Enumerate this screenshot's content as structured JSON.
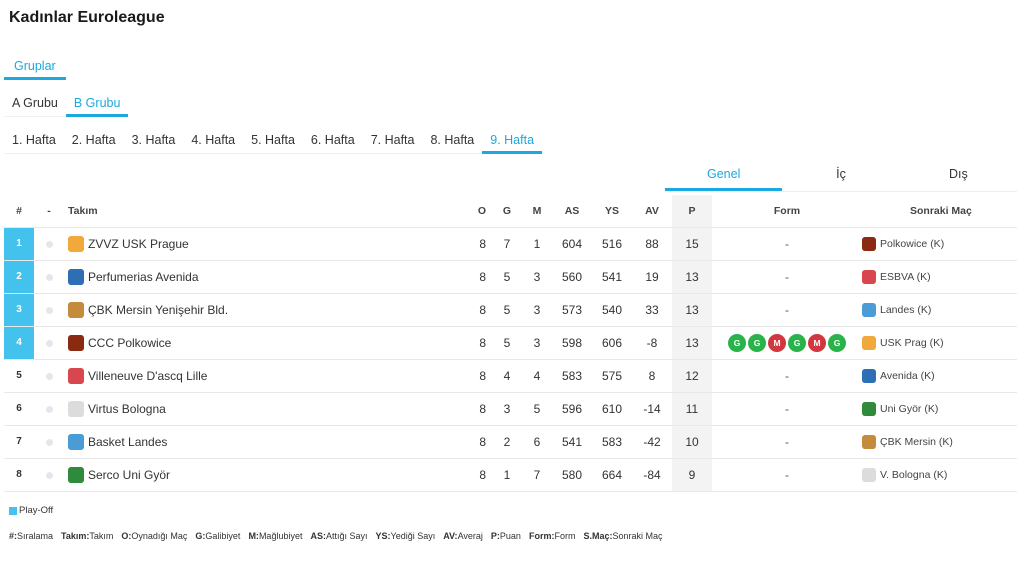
{
  "title": "Kadınlar Euroleague",
  "groups_tab": {
    "label": "Gruplar"
  },
  "group_tabs": [
    {
      "label": "A Grubu",
      "active": false
    },
    {
      "label": "B Grubu",
      "active": true
    }
  ],
  "week_tabs": [
    {
      "label": "1. Hafta",
      "active": false
    },
    {
      "label": "2. Hafta",
      "active": false
    },
    {
      "label": "3. Hafta",
      "active": false
    },
    {
      "label": "4. Hafta",
      "active": false
    },
    {
      "label": "5. Hafta",
      "active": false
    },
    {
      "label": "6. Hafta",
      "active": false
    },
    {
      "label": "7. Hafta",
      "active": false
    },
    {
      "label": "8. Hafta",
      "active": false
    },
    {
      "label": "9. Hafta",
      "active": true
    }
  ],
  "view_tabs": [
    {
      "label": "Genel",
      "active": true
    },
    {
      "label": "İç",
      "active": false
    },
    {
      "label": "Dış",
      "active": false
    }
  ],
  "columns": {
    "rank": "#",
    "dot": "-",
    "team": "Takım",
    "o": "O",
    "g": "G",
    "m": "M",
    "as": "AS",
    "ys": "YS",
    "av": "AV",
    "p": "P",
    "form": "Form",
    "next": "Sonraki Maç"
  },
  "rows": [
    {
      "rank": "1",
      "playoff": true,
      "team": "ZVVZ USK Prague",
      "logo_color": "#f2a93b",
      "logo_text": "USK",
      "o": "8",
      "g": "7",
      "m": "1",
      "as": "604",
      "ys": "516",
      "av": "88",
      "p": "15",
      "form": [],
      "form_empty": "-",
      "next": "Polkowice (K)",
      "next_logo_color": "#8a2a10",
      "next_logo_text": "CCC"
    },
    {
      "rank": "2",
      "playoff": true,
      "team": "Perfumerias Avenida",
      "logo_color": "#2c6fb5",
      "logo_text": "PA",
      "o": "8",
      "g": "5",
      "m": "3",
      "as": "560",
      "ys": "541",
      "av": "19",
      "p": "13",
      "form": [],
      "form_empty": "-",
      "next": "ESBVA (K)",
      "next_logo_color": "#d8474e",
      "next_logo_text": "VL"
    },
    {
      "rank": "3",
      "playoff": true,
      "team": "ÇBK Mersin Yenişehir Bld.",
      "logo_color": "#c58b3c",
      "logo_text": "ÇBK",
      "o": "8",
      "g": "5",
      "m": "3",
      "as": "573",
      "ys": "540",
      "av": "33",
      "p": "13",
      "form": [],
      "form_empty": "-",
      "next": "Landes (K)",
      "next_logo_color": "#4a9bd6",
      "next_logo_text": "BL"
    },
    {
      "rank": "4",
      "playoff": true,
      "team": "CCC Polkowice",
      "logo_color": "#8a2a10",
      "logo_text": "CCC",
      "o": "8",
      "g": "5",
      "m": "3",
      "as": "598",
      "ys": "606",
      "av": "-8",
      "p": "13",
      "form": [
        "G",
        "G",
        "M",
        "G",
        "M",
        "G"
      ],
      "form_empty": "",
      "next": "USK Prag (K)",
      "next_logo_color": "#f2a93b",
      "next_logo_text": "USK"
    },
    {
      "rank": "5",
      "playoff": false,
      "team": "Villeneuve D'ascq Lille",
      "logo_color": "#d8474e",
      "logo_text": "VL",
      "o": "8",
      "g": "4",
      "m": "4",
      "as": "583",
      "ys": "575",
      "av": "8",
      "p": "12",
      "form": [],
      "form_empty": "-",
      "next": "Avenida (K)",
      "next_logo_color": "#2c6fb5",
      "next_logo_text": "PA"
    },
    {
      "rank": "6",
      "playoff": false,
      "team": "Virtus Bologna",
      "logo_color": "#dcdcdc",
      "logo_text": "VB",
      "o": "8",
      "g": "3",
      "m": "5",
      "as": "596",
      "ys": "610",
      "av": "-14",
      "p": "11",
      "form": [],
      "form_empty": "-",
      "next": "Uni Györ (K)",
      "next_logo_color": "#2f8a3c",
      "next_logo_text": "UG"
    },
    {
      "rank": "7",
      "playoff": false,
      "team": "Basket Landes",
      "logo_color": "#4a9bd6",
      "logo_text": "BL",
      "o": "8",
      "g": "2",
      "m": "6",
      "as": "541",
      "ys": "583",
      "av": "-42",
      "p": "10",
      "form": [],
      "form_empty": "-",
      "next": "ÇBK Mersin (K)",
      "next_logo_color": "#c58b3c",
      "next_logo_text": "ÇBK"
    },
    {
      "rank": "8",
      "playoff": false,
      "team": "Serco Uni Györ",
      "logo_color": "#2f8a3c",
      "logo_text": "UG",
      "o": "8",
      "g": "1",
      "m": "7",
      "as": "580",
      "ys": "664",
      "av": "-84",
      "p": "9",
      "form": [],
      "form_empty": "-",
      "next": "V. Bologna (K)",
      "next_logo_color": "#dcdcdc",
      "next_logo_text": "VB"
    }
  ],
  "legend": {
    "label": "Play-Off",
    "color": "#44c2ee"
  },
  "abbreviations": [
    {
      "key": "#:",
      "value": "Sıralama"
    },
    {
      "key": "Takım:",
      "value": "Takım"
    },
    {
      "key": "O:",
      "value": "Oynadığı Maç"
    },
    {
      "key": "G:",
      "value": "Galibiyet"
    },
    {
      "key": "M:",
      "value": "Mağlubiyet"
    },
    {
      "key": "AS:",
      "value": "Attığı Sayı"
    },
    {
      "key": "YS:",
      "value": "Yediği Sayı"
    },
    {
      "key": "AV:",
      "value": "Averaj"
    },
    {
      "key": "P:",
      "value": "Puan"
    },
    {
      "key": "Form:",
      "value": "Form"
    },
    {
      "key": "S.Maç:",
      "value": "Sonraki Maç"
    }
  ]
}
